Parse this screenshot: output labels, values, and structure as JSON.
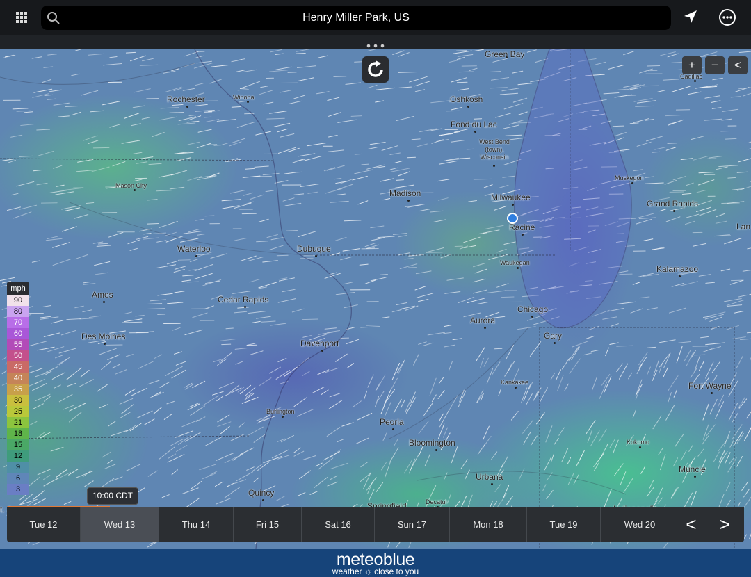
{
  "search": {
    "location": "Henry Miller Park, US"
  },
  "map": {
    "cities": [
      {
        "name": "Green Bay",
        "size": "big"
      },
      {
        "name": "Rochester",
        "size": "big"
      },
      {
        "name": "Winona",
        "size": "small"
      },
      {
        "name": "Oshkosh",
        "size": "big"
      },
      {
        "name": "Fond du Lac",
        "size": "big"
      },
      {
        "name": "West Bend (town), Wisconsin",
        "size": "small"
      },
      {
        "name": "Cadillac",
        "size": "small"
      },
      {
        "name": "Mason City",
        "size": "small"
      },
      {
        "name": "Madison",
        "size": "big"
      },
      {
        "name": "Milwaukee",
        "size": "big"
      },
      {
        "name": "Muskegon",
        "size": "small"
      },
      {
        "name": "Grand Rapids",
        "size": "big"
      },
      {
        "name": "Racine",
        "size": "big"
      },
      {
        "name": "Lan",
        "size": "big"
      },
      {
        "name": "Waterloo",
        "size": "big"
      },
      {
        "name": "Dubuque",
        "size": "big"
      },
      {
        "name": "Waukegan",
        "size": "small"
      },
      {
        "name": "Kalamazoo",
        "size": "big"
      },
      {
        "name": "Ames",
        "size": "big"
      },
      {
        "name": "Cedar Rapids",
        "size": "big"
      },
      {
        "name": "Chicago",
        "size": "big"
      },
      {
        "name": "Aurora",
        "size": "big"
      },
      {
        "name": "Des Moines",
        "size": "big"
      },
      {
        "name": "Gary",
        "size": "big"
      },
      {
        "name": "Davenport",
        "size": "big"
      },
      {
        "name": "Kankakee",
        "size": "small"
      },
      {
        "name": "Fort Wayne",
        "size": "big"
      },
      {
        "name": "Burlington",
        "size": "small"
      },
      {
        "name": "Peoria",
        "size": "big"
      },
      {
        "name": "Bloomington",
        "size": "big"
      },
      {
        "name": "Kokomo",
        "size": "small"
      },
      {
        "name": "Muncie",
        "size": "big"
      },
      {
        "name": "Urbana",
        "size": "big"
      },
      {
        "name": "Quincy",
        "size": "big"
      },
      {
        "name": "Springfield",
        "size": "big"
      },
      {
        "name": "Decatur",
        "size": "small"
      },
      {
        "name": "Indianapolis",
        "size": "big"
      },
      {
        "name": "t. Joseph",
        "size": "big"
      }
    ],
    "controls": {
      "zoom_in": "+",
      "zoom_out": "−",
      "collapse": "<"
    }
  },
  "legend": {
    "unit": "mph",
    "values": [
      "90",
      "80",
      "70",
      "60",
      "55",
      "50",
      "45",
      "40",
      "35",
      "30",
      "25",
      "21",
      "18",
      "15",
      "12",
      "9",
      "6",
      "3"
    ],
    "colors": [
      "#f1e1ea",
      "#c9a3f0",
      "#b86ee8",
      "#a957d8",
      "#b24bb8",
      "#c3508c",
      "#c96a66",
      "#c58458",
      "#c8a04a",
      "#c9bf3e",
      "#b9c83a",
      "#8cc43e",
      "#5fb44a",
      "#4aa866",
      "#3f9c7c",
      "#4f8fa6",
      "#5f86b8",
      "#6a7ec4"
    ]
  },
  "timeline": {
    "current_time": "10:00 CDT",
    "progress": 0.14,
    "selected_day": "Wed 13",
    "days": [
      "Tue 12",
      "Wed 13",
      "Thu 14",
      "Fri 15",
      "Sat 16",
      "Sun 17",
      "Mon 18",
      "Tue 19",
      "Wed 20"
    ],
    "prev": "<",
    "next": ">"
  },
  "footer": {
    "brand": "meteoblue",
    "tagline": "weather ☼ close to you"
  }
}
